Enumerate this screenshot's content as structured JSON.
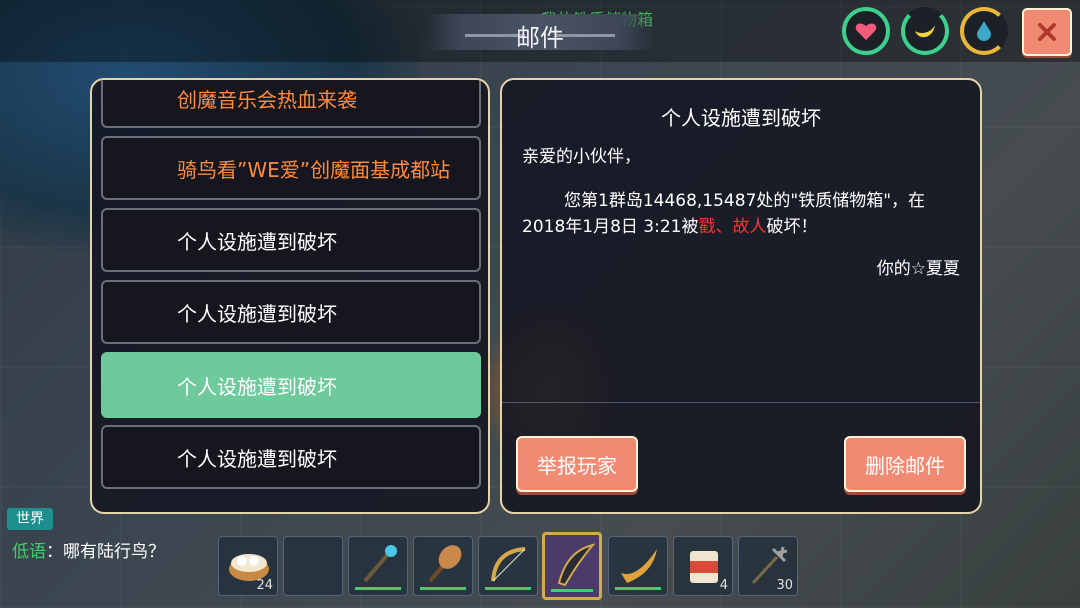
{
  "header": {
    "background_title": "我的铁质储物箱",
    "title": "邮件",
    "stat_icons": [
      "heart-icon",
      "banana-icon",
      "water-drop-icon"
    ],
    "close_icon": "close-icon"
  },
  "mail_list": [
    {
      "title": "创魔音乐会热血来袭",
      "style": "orange"
    },
    {
      "title": "骑鸟看”WE爱”创魔面基成都站",
      "style": "orange"
    },
    {
      "title": "个人设施遭到破坏",
      "style": "normal"
    },
    {
      "title": "个人设施遭到破坏",
      "style": "normal"
    },
    {
      "title": "个人设施遭到破坏",
      "style": "selected"
    },
    {
      "title": "个人设施遭到破坏",
      "style": "normal"
    }
  ],
  "detail": {
    "title": "个人设施遭到破坏",
    "greeting": "亲爱的小伙伴，",
    "body_part1": "您第1群岛14468,15487处的\"铁质储物箱\"，在2018年1月8日 3:21被",
    "body_highlight": "戳、故人",
    "body_part2": "破坏！",
    "signature": "你的☆夏夏",
    "report_button": "举报玩家",
    "delete_button": "删除邮件"
  },
  "chat": {
    "channel_tab": "世界",
    "channel": "低语",
    "separator": "：",
    "message": "哪有陆行鸟？"
  },
  "hotbar": [
    {
      "icon": "dumpling-basket-icon",
      "count": "24"
    },
    {
      "icon": "empty-slot",
      "count": ""
    },
    {
      "icon": "blue-staff-icon",
      "count": ""
    },
    {
      "icon": "wooden-club-icon",
      "count": ""
    },
    {
      "icon": "bow-icon",
      "count": ""
    },
    {
      "icon": "dark-blade-icon",
      "count": ""
    },
    {
      "icon": "golden-horn-icon",
      "count": ""
    },
    {
      "icon": "seed-bag-icon",
      "count": "4"
    },
    {
      "icon": "trident-icon",
      "count": "30"
    }
  ],
  "colors": {
    "accent_green": "#6ec99b",
    "button": "#f08a72",
    "highlight_red": "#ff3030",
    "orange_text": "#ff8a3c"
  }
}
